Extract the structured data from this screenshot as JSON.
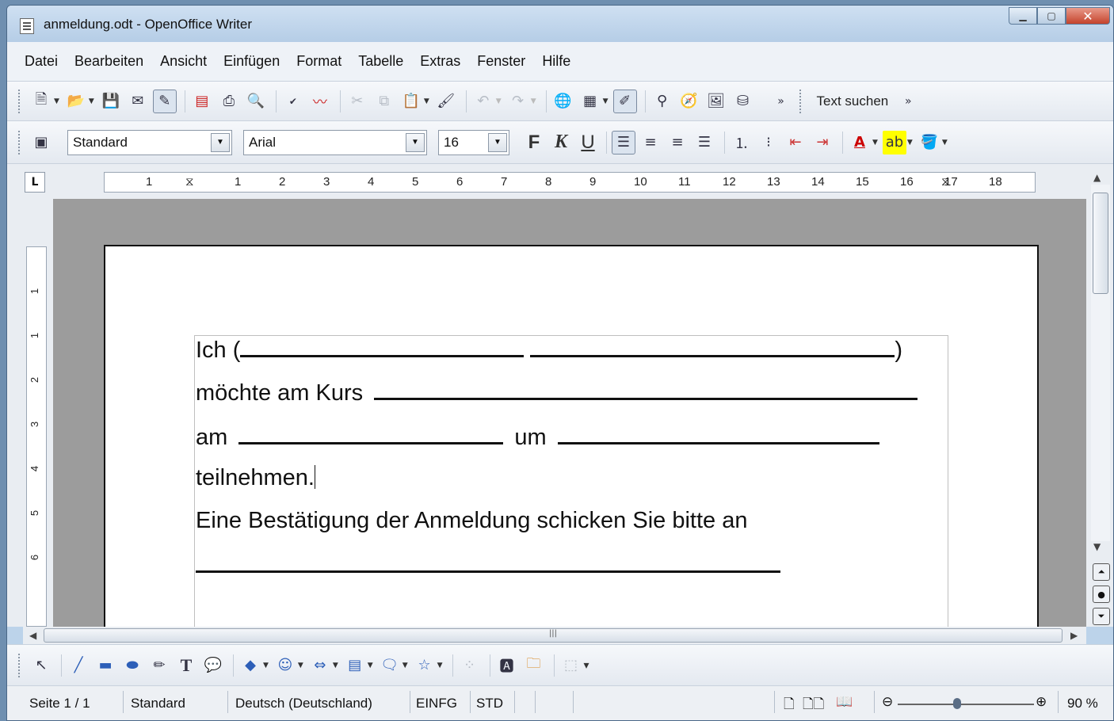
{
  "window": {
    "title": "anmeldung.odt - OpenOffice Writer",
    "minimize_icon": "minimize-icon",
    "maximize_icon": "maximize-icon",
    "close_icon": "close-icon"
  },
  "menu": [
    "Datei",
    "Bearbeiten",
    "Ansicht",
    "Einfügen",
    "Format",
    "Tabelle",
    "Extras",
    "Fenster",
    "Hilfe"
  ],
  "toolbar_standard": {
    "search_label": "Text suchen"
  },
  "toolbar_format": {
    "style_value": "Standard",
    "font_value": "Arial",
    "size_value": "16",
    "bold_label": "F",
    "italic_label": "K",
    "underline_label": "U"
  },
  "ruler": {
    "corner_label": "L",
    "ticks": [
      "1",
      "1",
      "2",
      "3",
      "4",
      "5",
      "6",
      "7",
      "8",
      "9",
      "10",
      "11",
      "12",
      "13",
      "14",
      "15",
      "16",
      "17",
      "18"
    ],
    "vticks": [
      "1",
      "1",
      "2",
      "3",
      "4",
      "5",
      "6"
    ]
  },
  "document": {
    "line1_prefix": "Ich (",
    "line1_suffix": ")",
    "line2_prefix": "möchte am Kurs",
    "line3_prefix": "am",
    "line3_middle": "um",
    "line4": "teilnehmen.",
    "line5": "Eine Bestätigung der Anmeldung schicken Sie bitte an"
  },
  "statusbar": {
    "page": "Seite 1 / 1",
    "style": "Standard",
    "language": "Deutsch (Deutschland)",
    "insert_mode": "EINFG",
    "selection_mode": "STD",
    "zoom": "90 %"
  },
  "colors": {
    "accent": "#5a6d85",
    "page": "#ffffff",
    "canvas": "#9c9c9c"
  }
}
